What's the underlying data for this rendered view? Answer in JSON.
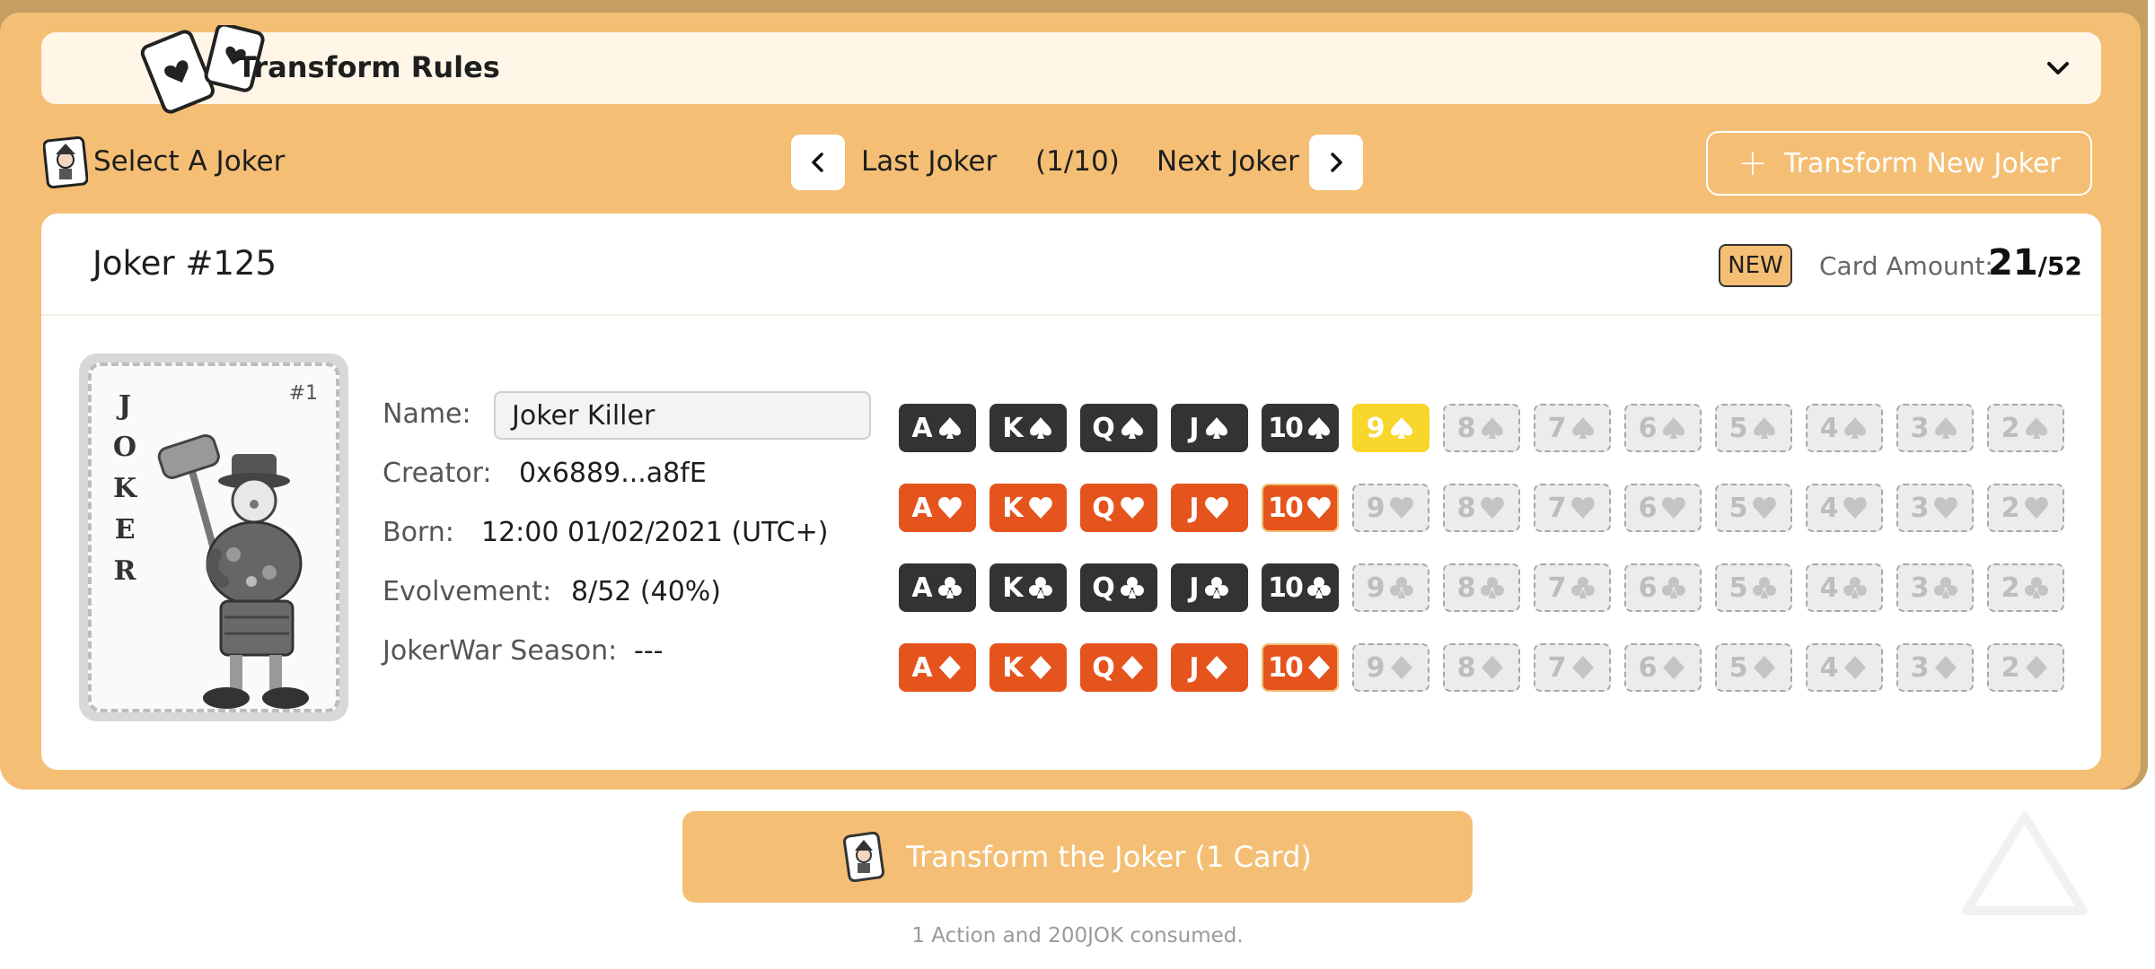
{
  "rules": {
    "title": "Transform Rules",
    "icon": "playing-cards-icon",
    "toggle_icon": "chevron-down-icon"
  },
  "nav": {
    "select_label": "Select A Joker",
    "last_label": "Last Joker",
    "counter": "(1/10)",
    "next_label": "Next Joker",
    "new_button_label": "Transform New Joker"
  },
  "joker": {
    "title": "Joker #125",
    "badge": "NEW",
    "amount_label": "Card Amount:",
    "amount_value": "21",
    "amount_total": "/52",
    "card_number": "#1",
    "card_letters": [
      "J",
      "O",
      "K",
      "E",
      "R"
    ],
    "details": {
      "name_label": "Name:",
      "name_value": "Joker Killer",
      "creator_label": "Creator:",
      "creator_value": "0x6889...a8fE",
      "born_label": "Born:",
      "born_value": "12:00 01/02/2021 (UTC+)",
      "evolvement_label": "Evolvement:",
      "evolvement_value": "8/52 (40%)",
      "season_label": "JokerWar Season:",
      "season_value": "---"
    }
  },
  "deck": {
    "ranks": [
      "A",
      "K",
      "Q",
      "J",
      "10",
      "9",
      "8",
      "7",
      "6",
      "5",
      "4",
      "3",
      "2"
    ],
    "rows": [
      {
        "suit": "spade",
        "states": [
          "black",
          "black",
          "black",
          "black",
          "black",
          "yellow",
          "empty",
          "empty",
          "empty",
          "empty",
          "empty",
          "empty",
          "empty"
        ]
      },
      {
        "suit": "heart",
        "states": [
          "red",
          "red",
          "red",
          "red",
          "red-new",
          "empty",
          "empty",
          "empty",
          "empty",
          "empty",
          "empty",
          "empty",
          "empty"
        ]
      },
      {
        "suit": "club",
        "states": [
          "black",
          "black",
          "black",
          "black",
          "black",
          "empty",
          "empty",
          "empty",
          "empty",
          "empty",
          "empty",
          "empty",
          "empty"
        ]
      },
      {
        "suit": "diamond",
        "states": [
          "red",
          "red",
          "red",
          "red",
          "red-new",
          "empty",
          "empty",
          "empty",
          "empty",
          "empty",
          "empty",
          "empty",
          "empty"
        ]
      }
    ]
  },
  "footer": {
    "transform_label": "Transform the Joker (1 Card)",
    "consumed_text": "1 Action and 200JOK consumed."
  },
  "colors": {
    "panel": "#f4bf74",
    "black_card": "#333333",
    "red_card": "#e4541c",
    "yellow_card": "#f8d62c"
  }
}
